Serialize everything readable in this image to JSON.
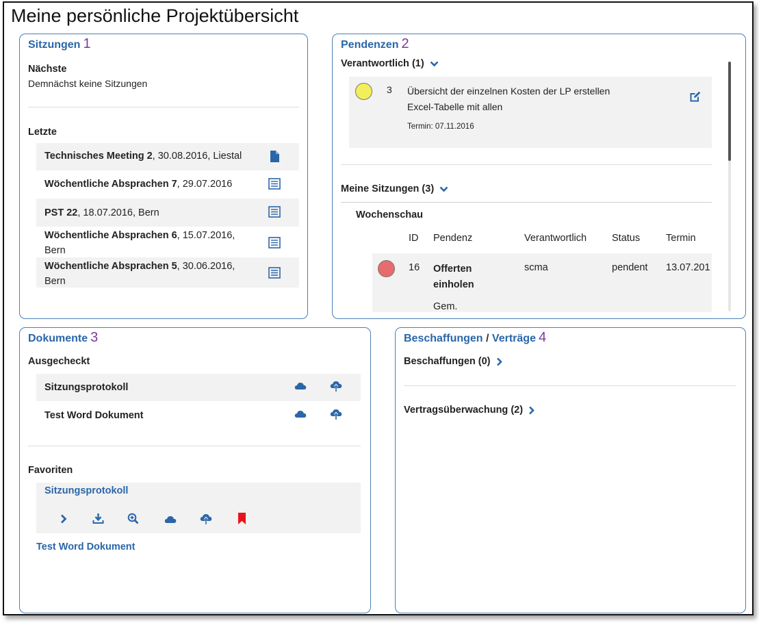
{
  "page": {
    "title": "Meine persönliche Projektübersicht"
  },
  "sitzungen": {
    "heading": "Sitzungen",
    "number": "1",
    "next_label": "Nächste",
    "next_text": "Demnächst keine Sitzungen",
    "last_label": "Letzte",
    "items": [
      {
        "name": "Technisches Meeting 2",
        "details": ", 30.08.2016, Liestal",
        "icon": "document-icon"
      },
      {
        "name": "Wöchentliche Absprachen 7",
        "details": ", 29.07.2016",
        "icon": "protocol-icon"
      },
      {
        "name": "PST 22",
        "details": ", 18.07.2016, Bern",
        "icon": "protocol-icon"
      },
      {
        "name": "Wöchentliche Absprachen 6",
        "details": ", 15.07.2016,",
        "line2": "Bern",
        "icon": "protocol-icon"
      },
      {
        "name": "Wöchentliche Absprachen 5",
        "details": ", 30.06.2016,",
        "line2": "Bern",
        "icon": "protocol-icon"
      }
    ]
  },
  "pendenzen": {
    "heading": "Pendenzen",
    "number": "2",
    "verantwortlich_label": "Verantwortlich (1)",
    "task": {
      "id": "3",
      "line1": "Übersicht der einzelnen Kosten der LP erstellen",
      "line2": "Excel-Tabelle mit allen",
      "termin": "Termin: 07.11.2016",
      "status_color": "#f2ef5a"
    },
    "meine_label": "Meine Sitzungen (3)",
    "group": "Wochenschau",
    "table": {
      "headers": [
        "ID",
        "Pendenz",
        "Verantwortlich",
        "Status",
        "Termin"
      ],
      "row": {
        "id": "16",
        "pendenz1": "Offerten",
        "pendenz2": "einholen",
        "verantwortlich": "scma",
        "status": "pendent",
        "termin": "13.07.201",
        "note": "Gem.",
        "status_color": "#e96b6b"
      }
    }
  },
  "dokumente": {
    "heading": "Dokumente",
    "number": "3",
    "checked_out_label": "Ausgecheckt",
    "checked_out": [
      "Sitzungsprotokoll",
      "Test Word Dokument"
    ],
    "favorites_label": "Favoriten",
    "favorites": [
      "Sitzungsprotokoll",
      "Test Word Dokument"
    ]
  },
  "beschaffungen": {
    "heading_a": "Beschaffungen",
    "heading_sep": " / ",
    "heading_b": "Verträge",
    "number": "4",
    "items": [
      "Beschaffungen (0)",
      "Vertragsüberwachung (2)"
    ]
  },
  "colors": {
    "accent": "#2a66a8",
    "number": "#7b3aa0",
    "bookmark": "#e8131c",
    "border": "#4a7fb5"
  }
}
